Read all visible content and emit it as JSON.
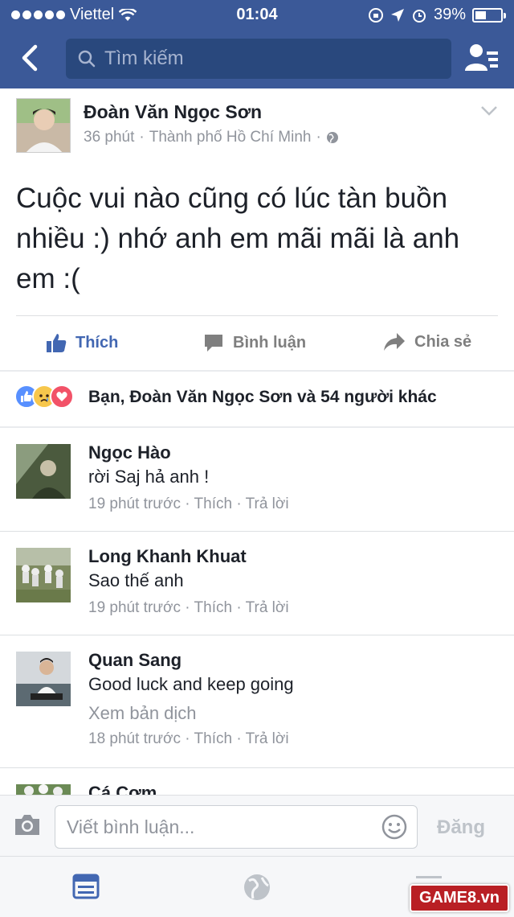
{
  "status_bar": {
    "carrier": "Viettel",
    "time": "01:04",
    "battery": "39%"
  },
  "nav": {
    "search_placeholder": "Tìm kiếm"
  },
  "post": {
    "author": "Đoàn Văn Ngọc Sơn",
    "time_ago": "36 phút",
    "location": "Thành phố Hồ Chí Minh",
    "text": "Cuộc vui nào cũng có lúc tàn buồn nhiều :) nhớ anh em mãi mãi là anh em :(",
    "actions": {
      "like": "Thích",
      "comment": "Bình luận",
      "share": "Chia sẻ"
    },
    "reactions_text": "Bạn, Đoàn Văn Ngọc Sơn và 54 người khác"
  },
  "comments": [
    {
      "name": "Ngọc Hào",
      "text": "rời Saj hả anh !",
      "time": "19 phút trước",
      "like": "Thích",
      "reply": "Trả lời"
    },
    {
      "name": "Long Khanh Khuat",
      "text": "Sao thế anh",
      "time": "19 phút trước",
      "like": "Thích",
      "reply": "Trả lời"
    },
    {
      "name": "Quan Sang",
      "text": "Good luck and keep going",
      "translate": "Xem bản dịch",
      "time": "18 phút trước",
      "like": "Thích",
      "reply": "Trả lời"
    },
    {
      "name": "Cá Cơm"
    }
  ],
  "composer": {
    "placeholder": "Viết bình luận...",
    "post_label": "Đăng"
  },
  "watermark": "GAME8.vn",
  "colors": {
    "brand_blue": "#3b5998",
    "like_blue": "#4267b2",
    "meta_gray": "#90949c"
  }
}
